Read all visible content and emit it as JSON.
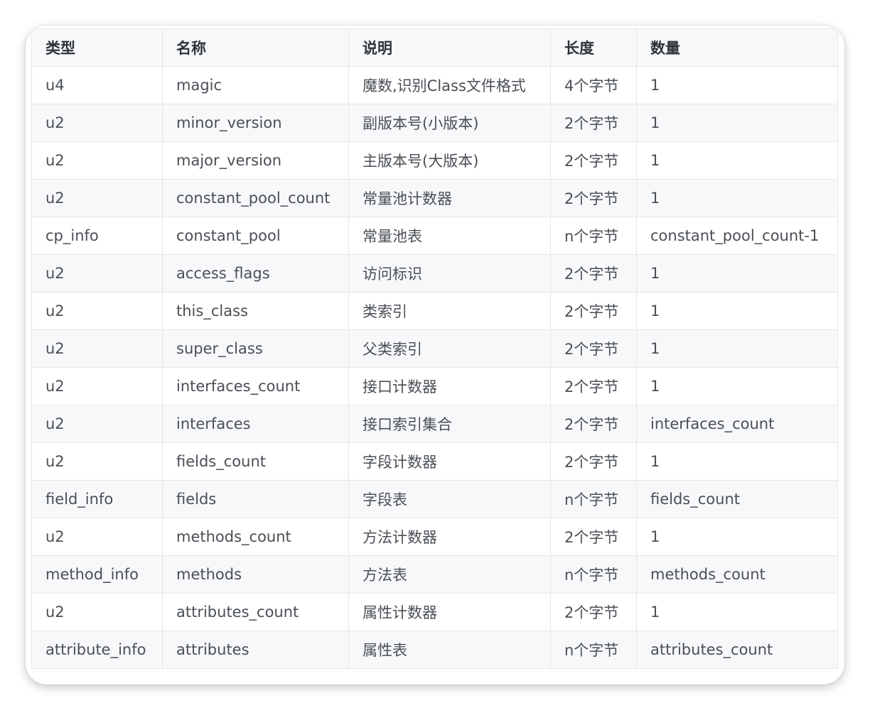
{
  "table": {
    "headers": [
      "类型",
      "名称",
      "说明",
      "长度",
      "数量"
    ],
    "rows": [
      [
        "u4",
        "magic",
        "魔数,识别Class文件格式",
        "4个字节",
        "1"
      ],
      [
        "u2",
        "minor_version",
        "副版本号(小版本)",
        "2个字节",
        "1"
      ],
      [
        "u2",
        "major_version",
        "主版本号(大版本)",
        "2个字节",
        "1"
      ],
      [
        "u2",
        "constant_pool_count",
        "常量池计数器",
        "2个字节",
        "1"
      ],
      [
        "cp_info",
        "constant_pool",
        "常量池表",
        "n个字节",
        "constant_pool_count-1"
      ],
      [
        "u2",
        "access_flags",
        "访问标识",
        "2个字节",
        "1"
      ],
      [
        "u2",
        "this_class",
        "类索引",
        "2个字节",
        "1"
      ],
      [
        "u2",
        "super_class",
        "父类索引",
        "2个字节",
        "1"
      ],
      [
        "u2",
        "interfaces_count",
        "接口计数器",
        "2个字节",
        "1"
      ],
      [
        "u2",
        "interfaces",
        "接口索引集合",
        "2个字节",
        "interfaces_count"
      ],
      [
        "u2",
        "fields_count",
        "字段计数器",
        "2个字节",
        "1"
      ],
      [
        "field_info",
        "fields",
        "字段表",
        "n个字节",
        "fields_count"
      ],
      [
        "u2",
        "methods_count",
        "方法计数器",
        "2个字节",
        "1"
      ],
      [
        "method_info",
        "methods",
        "方法表",
        "n个字节",
        "methods_count"
      ],
      [
        "u2",
        "attributes_count",
        "属性计数器",
        "2个字节",
        "1"
      ],
      [
        "attribute_info",
        "attributes",
        "属性表",
        "n个字节",
        "attributes_count"
      ]
    ]
  }
}
